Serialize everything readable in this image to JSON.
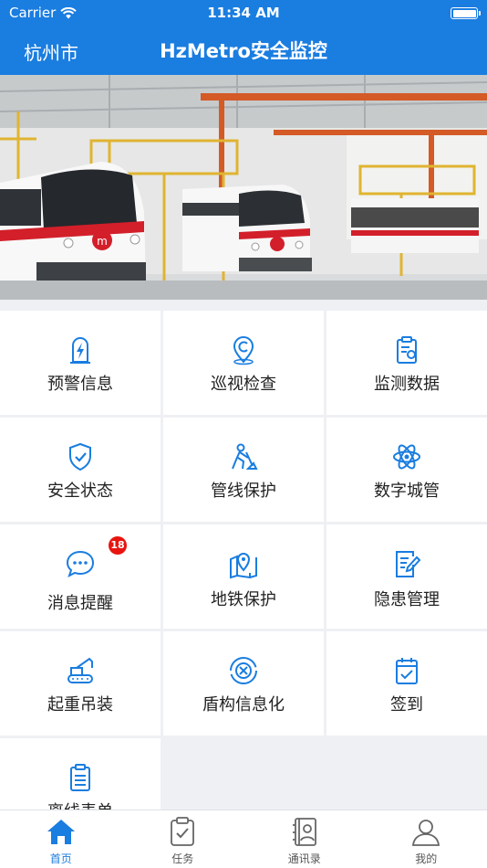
{
  "status_bar": {
    "carrier": "Carrier",
    "time": "11:34 AM"
  },
  "nav": {
    "city": "杭州市",
    "title": "HzMetro安全监控"
  },
  "colors": {
    "primary": "#1a7de0",
    "badge": "#e8140f",
    "background": "#eef0f4"
  },
  "grid": {
    "items": [
      {
        "label": "预警信息",
        "icon": "warning-lightning-icon"
      },
      {
        "label": "巡视检查",
        "icon": "patrol-location-icon"
      },
      {
        "label": "监测数据",
        "icon": "clipboard-data-icon"
      },
      {
        "label": "安全状态",
        "icon": "shield-check-icon"
      },
      {
        "label": "管线保护",
        "icon": "worker-digging-icon"
      },
      {
        "label": "数字城管",
        "icon": "atom-icon"
      },
      {
        "label": "消息提醒",
        "icon": "chat-bubble-icon",
        "badge": "18"
      },
      {
        "label": "地铁保护",
        "icon": "map-pin-icon"
      },
      {
        "label": "隐患管理",
        "icon": "document-edit-icon"
      },
      {
        "label": "起重吊装",
        "icon": "crane-icon"
      },
      {
        "label": "盾构信息化",
        "icon": "shield-machine-icon"
      },
      {
        "label": "签到",
        "icon": "calendar-check-icon"
      },
      {
        "label": "离线表单",
        "icon": "clipboard-list-icon"
      }
    ]
  },
  "tabbar": {
    "tabs": [
      {
        "label": "首页",
        "icon": "home-icon",
        "active": true
      },
      {
        "label": "任务",
        "icon": "task-clipboard-icon",
        "active": false
      },
      {
        "label": "通讯录",
        "icon": "contacts-book-icon",
        "active": false
      },
      {
        "label": "我的",
        "icon": "user-profile-icon",
        "active": false
      }
    ]
  }
}
